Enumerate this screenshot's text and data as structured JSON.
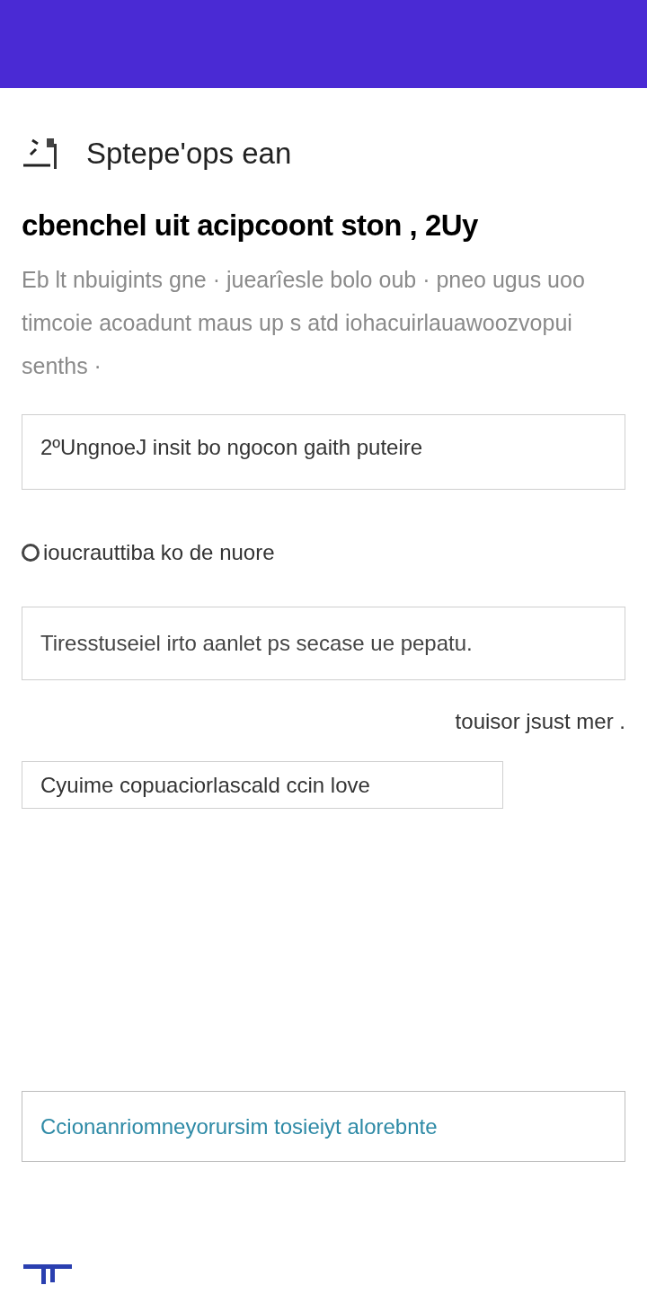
{
  "title": "Sptepe'ops ean",
  "heading": "cbenchel uit acipcoont ston , 2Uy",
  "description": "Eb lt nbuigints gne · juearîesle bolo oub · pneo ugus uoo timcoie acoadunt maus up s atd iohacuirlauawoozvopui senths ·",
  "field_1": {
    "value": "2ºUngnoeJ insit bo ngocon gaith puteire"
  },
  "option": {
    "label": "ioucrauttiba ko de nuore",
    "selected": false
  },
  "field_2": {
    "value": "Tiresstuseiel irto aanlet ps secase ue pepatu."
  },
  "hint": "touisor jsust mer .",
  "field_3": {
    "value": "Cyuime copuaciorlascald ccin love"
  },
  "field_4": {
    "value": "Ccionanriomneyorursim tosieiyt alorebnte"
  }
}
